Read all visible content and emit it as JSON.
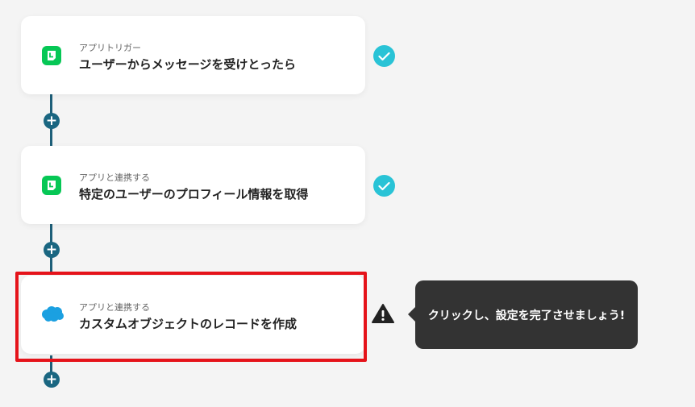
{
  "flow": {
    "steps": [
      {
        "label": "アプリトリガー",
        "title": "ユーザーからメッセージを受けとったら",
        "app_icon": "line-icon",
        "status": "complete"
      },
      {
        "label": "アプリと連携する",
        "title": "特定のユーザーのプロフィール情報を取得",
        "app_icon": "line-icon",
        "status": "complete"
      },
      {
        "label": "アプリと連携する",
        "title": "カスタムオブジェクトのレコードを作成",
        "app_icon": "salesforce-icon",
        "status": "warning"
      }
    ],
    "add_step_glyph": "+"
  },
  "tooltip": {
    "text": "クリックし、設定を完了させましょう!"
  },
  "colors": {
    "background": "#f4f4f4",
    "line_green": "#06c755",
    "salesforce_blue": "#1ba0e1",
    "check_teal": "#29c3d6",
    "connector": "#1e5f79",
    "highlight_red": "#e5131a",
    "tooltip_bg": "#333333"
  }
}
